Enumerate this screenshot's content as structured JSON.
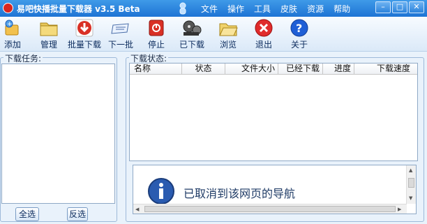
{
  "window": {
    "title": "易吧快播批量下载器 v3.5 Beta",
    "menus": [
      "文件",
      "操作",
      "工具",
      "皮肤",
      "资源",
      "帮助"
    ],
    "controls": [
      "minimize-icon",
      "maximize-icon",
      "close-icon"
    ]
  },
  "toolbar": {
    "add": "添加",
    "manage": "管理",
    "batch_download": "批量下载",
    "next_batch": "下一批",
    "stop": "停止",
    "downloaded": "已下载",
    "browse": "浏览",
    "exit": "退出",
    "about": "关于"
  },
  "tasks": {
    "title": "下载任务:",
    "select_all": "全选",
    "invert": "反选"
  },
  "status": {
    "title": "下载状态:",
    "columns": [
      "名称",
      "状态",
      "文件大小",
      "已经下载",
      "进度",
      "下载速度"
    ]
  },
  "message": {
    "text": "已取消到该网页的导航"
  },
  "colors": {
    "titlebar": "#2a83dd",
    "stop_red": "#d93025",
    "about_blue": "#1f5fd6"
  }
}
